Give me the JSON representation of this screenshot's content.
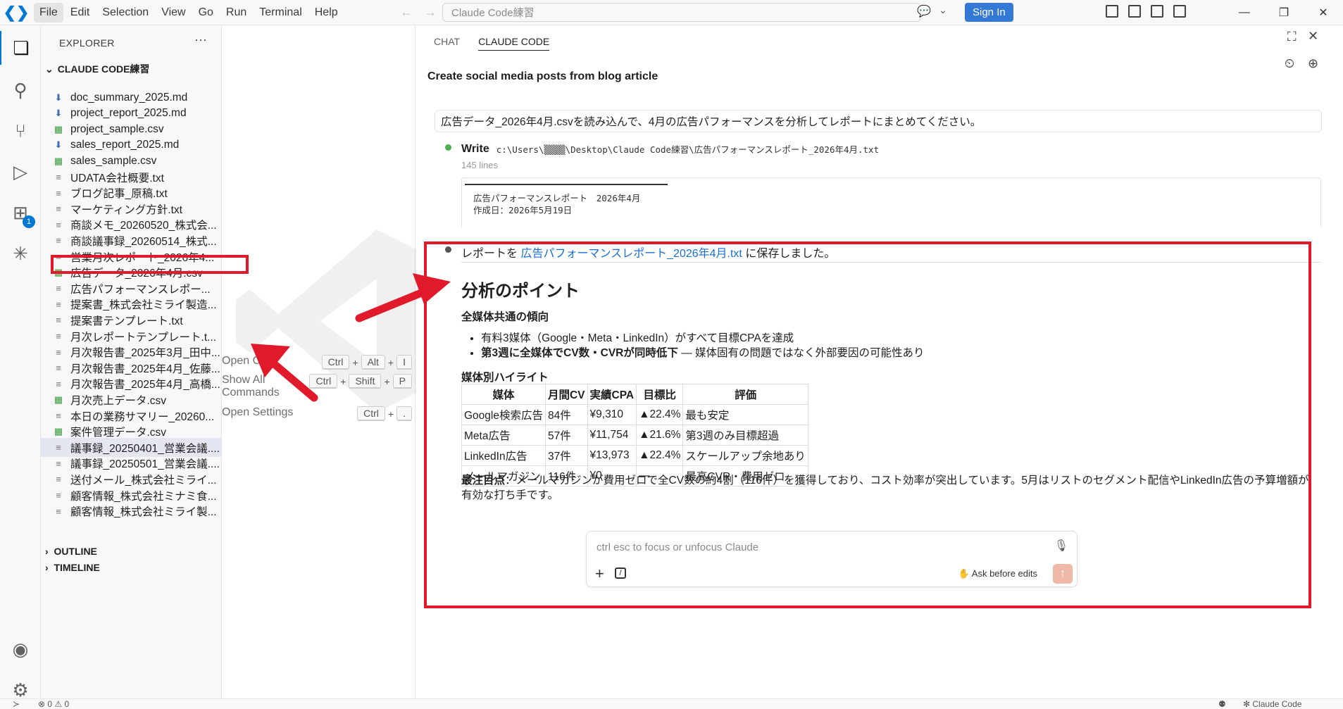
{
  "menu": [
    "File",
    "Edit",
    "Selection",
    "View",
    "Go",
    "Run",
    "Terminal",
    "Help"
  ],
  "title": {
    "search": "Claude Code練習",
    "sign_in": "Sign In"
  },
  "sidebar": {
    "header": "EXPLORER",
    "folder": "CLAUDE CODE練習",
    "files": [
      {
        "name": "doc_summary_2025.md",
        "type": "md"
      },
      {
        "name": "project_report_2025.md",
        "type": "md"
      },
      {
        "name": "project_sample.csv",
        "type": "csv"
      },
      {
        "name": "sales_report_2025.md",
        "type": "md"
      },
      {
        "name": "sales_sample.csv",
        "type": "csv"
      },
      {
        "name": "UDATA会社概要.txt",
        "type": "txt"
      },
      {
        "name": "ブログ記事_原稿.txt",
        "type": "txt"
      },
      {
        "name": "マーケティング方針.txt",
        "type": "txt"
      },
      {
        "name": "商談メモ_20260520_株式会...",
        "type": "txt"
      },
      {
        "name": "商談議事録_20260514_株式...",
        "type": "txt"
      },
      {
        "name": "営業月次レポート_2026年4...",
        "type": "txt"
      },
      {
        "name": "広告データ_2026年4月.csv",
        "type": "csv"
      },
      {
        "name": "広告パフォーマンスレポー...",
        "type": "txt"
      },
      {
        "name": "提案書_株式会社ミライ製造...",
        "type": "txt"
      },
      {
        "name": "提案書テンプレート.txt",
        "type": "txt"
      },
      {
        "name": "月次レポートテンプレート.t...",
        "type": "txt"
      },
      {
        "name": "月次報告書_2025年3月_田中...",
        "type": "txt"
      },
      {
        "name": "月次報告書_2025年4月_佐藤...",
        "type": "txt"
      },
      {
        "name": "月次報告書_2025年4月_高橋...",
        "type": "txt"
      },
      {
        "name": "月次売上データ.csv",
        "type": "csv"
      },
      {
        "name": "本日の業務サマリー_20260...",
        "type": "txt"
      },
      {
        "name": "案件管理データ.csv",
        "type": "csv"
      },
      {
        "name": "議事録_20250401_営業会議....",
        "type": "txt"
      },
      {
        "name": "議事録_20250501_営業会議....",
        "type": "txt"
      },
      {
        "name": "送付メール_株式会社ミライ...",
        "type": "txt"
      },
      {
        "name": "顧客情報_株式会社ミナミ食...",
        "type": "txt"
      },
      {
        "name": "顧客情報_株式会社ミライ製...",
        "type": "txt"
      }
    ],
    "outline": "OUTLINE",
    "timeline": "TIMELINE",
    "activity_badge": "1"
  },
  "editor": {
    "shortcuts": [
      {
        "label": "Open Chat",
        "keys": [
          "Ctrl",
          "Alt",
          "I"
        ]
      },
      {
        "label": "Show All Commands",
        "keys": [
          "Ctrl",
          "Shift",
          "P"
        ]
      },
      {
        "label": "Open Settings",
        "keys": [
          "Ctrl",
          "."
        ]
      }
    ]
  },
  "panel": {
    "tabs": [
      "CHAT",
      "CLAUDE CODE"
    ],
    "title": "Create social media posts from blog article",
    "user_message": "広告データ_2026年4月.csvを読み込んで、4月の広告パフォーマンスを分析してレポートにまとめてください。",
    "write_label": "Write",
    "write_path": "c:\\Users\\▒▒▒▒\\Desktop\\Claude Code練習\\広告パフォーマンスレポート_2026年4月.txt",
    "lines": "145 lines",
    "code_line1": "広告パフォーマンスレポート　2026年4月",
    "code_line2": "作成日：2026年5月19日",
    "saved_prefix": "レポートを",
    "saved_link": "広告パフォーマンスレポート_2026年4月.txt",
    "saved_suffix": "に保存しました。",
    "heading": "分析のポイント",
    "sub1": "全媒体共通の傾向",
    "bullet1": "有料3媒体（Google・Meta・LinkedIn）がすべて目標CPAを達成",
    "bullet2_bold": "第3週に全媒体でCV数・CVRが同時低下",
    "bullet2_rest": " — 媒体固有の問題ではなく外部要因の可能性あり",
    "sub2": "媒体別ハイライト",
    "table_headers": [
      "媒体",
      "月間CV",
      "実績CPA",
      "目標比",
      "評価"
    ],
    "table_rows": [
      [
        "Google検索広告",
        "84件",
        "¥9,310",
        "▲22.4%",
        "最も安定"
      ],
      [
        "Meta広告",
        "57件",
        "¥11,754",
        "▲21.6%",
        "第3週のみ目標超過"
      ],
      [
        "LinkedIn広告",
        "37件",
        "¥13,973",
        "▲22.4%",
        "スケールアップ余地あり"
      ],
      [
        "メールマガジン",
        "116件",
        "¥0",
        "—",
        "最高CVR・費用ゼロ"
      ]
    ],
    "summary_bold": "最注目点",
    "summary_text": "：メールマガジンが費用ゼロで全CV数の約4割（116件）を獲得しており、コスト効率が突出しています。5月はリストのセグメント配信やLinkedIn広告の予算増額が有効な打ち手です。",
    "input_placeholder": "ctrl esc to focus or unfocus Claude",
    "ask_mode": "Ask before edits"
  },
  "status": {
    "problems": "⊗ 0 ⚠ 0",
    "claude": "✻ Claude Code"
  }
}
